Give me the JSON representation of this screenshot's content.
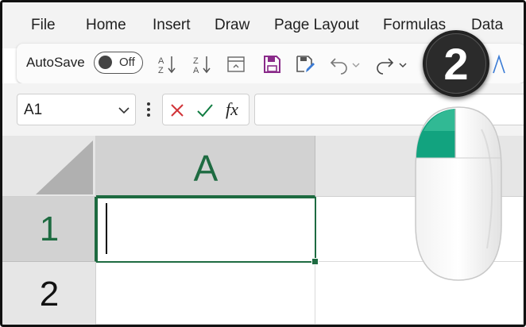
{
  "menu": {
    "items": [
      "File",
      "Home",
      "Insert",
      "Draw",
      "Page Layout",
      "Formulas",
      "Data"
    ]
  },
  "ribbon": {
    "autosave_label": "AutoSave",
    "toggle_state": "Off",
    "icons": [
      "sort-ascending-icon",
      "sort-descending-icon",
      "form-icon",
      "save-icon",
      "save-as-icon",
      "undo-icon",
      "redo-icon",
      "font-color-icon"
    ]
  },
  "namebox": {
    "value": "A1"
  },
  "formula_bar": {
    "fx_label": "fx",
    "value": ""
  },
  "grid": {
    "column_headers": [
      "A"
    ],
    "row_headers": [
      "1",
      "2"
    ],
    "active_cell": "A1"
  },
  "overlay": {
    "step_badge": "2",
    "mouse_button": "left-click"
  },
  "colors": {
    "excel_green": "#1e6b41",
    "mouse_button_green": "#12a37f",
    "cancel_red": "#d13438",
    "confirm_green": "#107c41",
    "save_purple": "#8a2b8a"
  }
}
